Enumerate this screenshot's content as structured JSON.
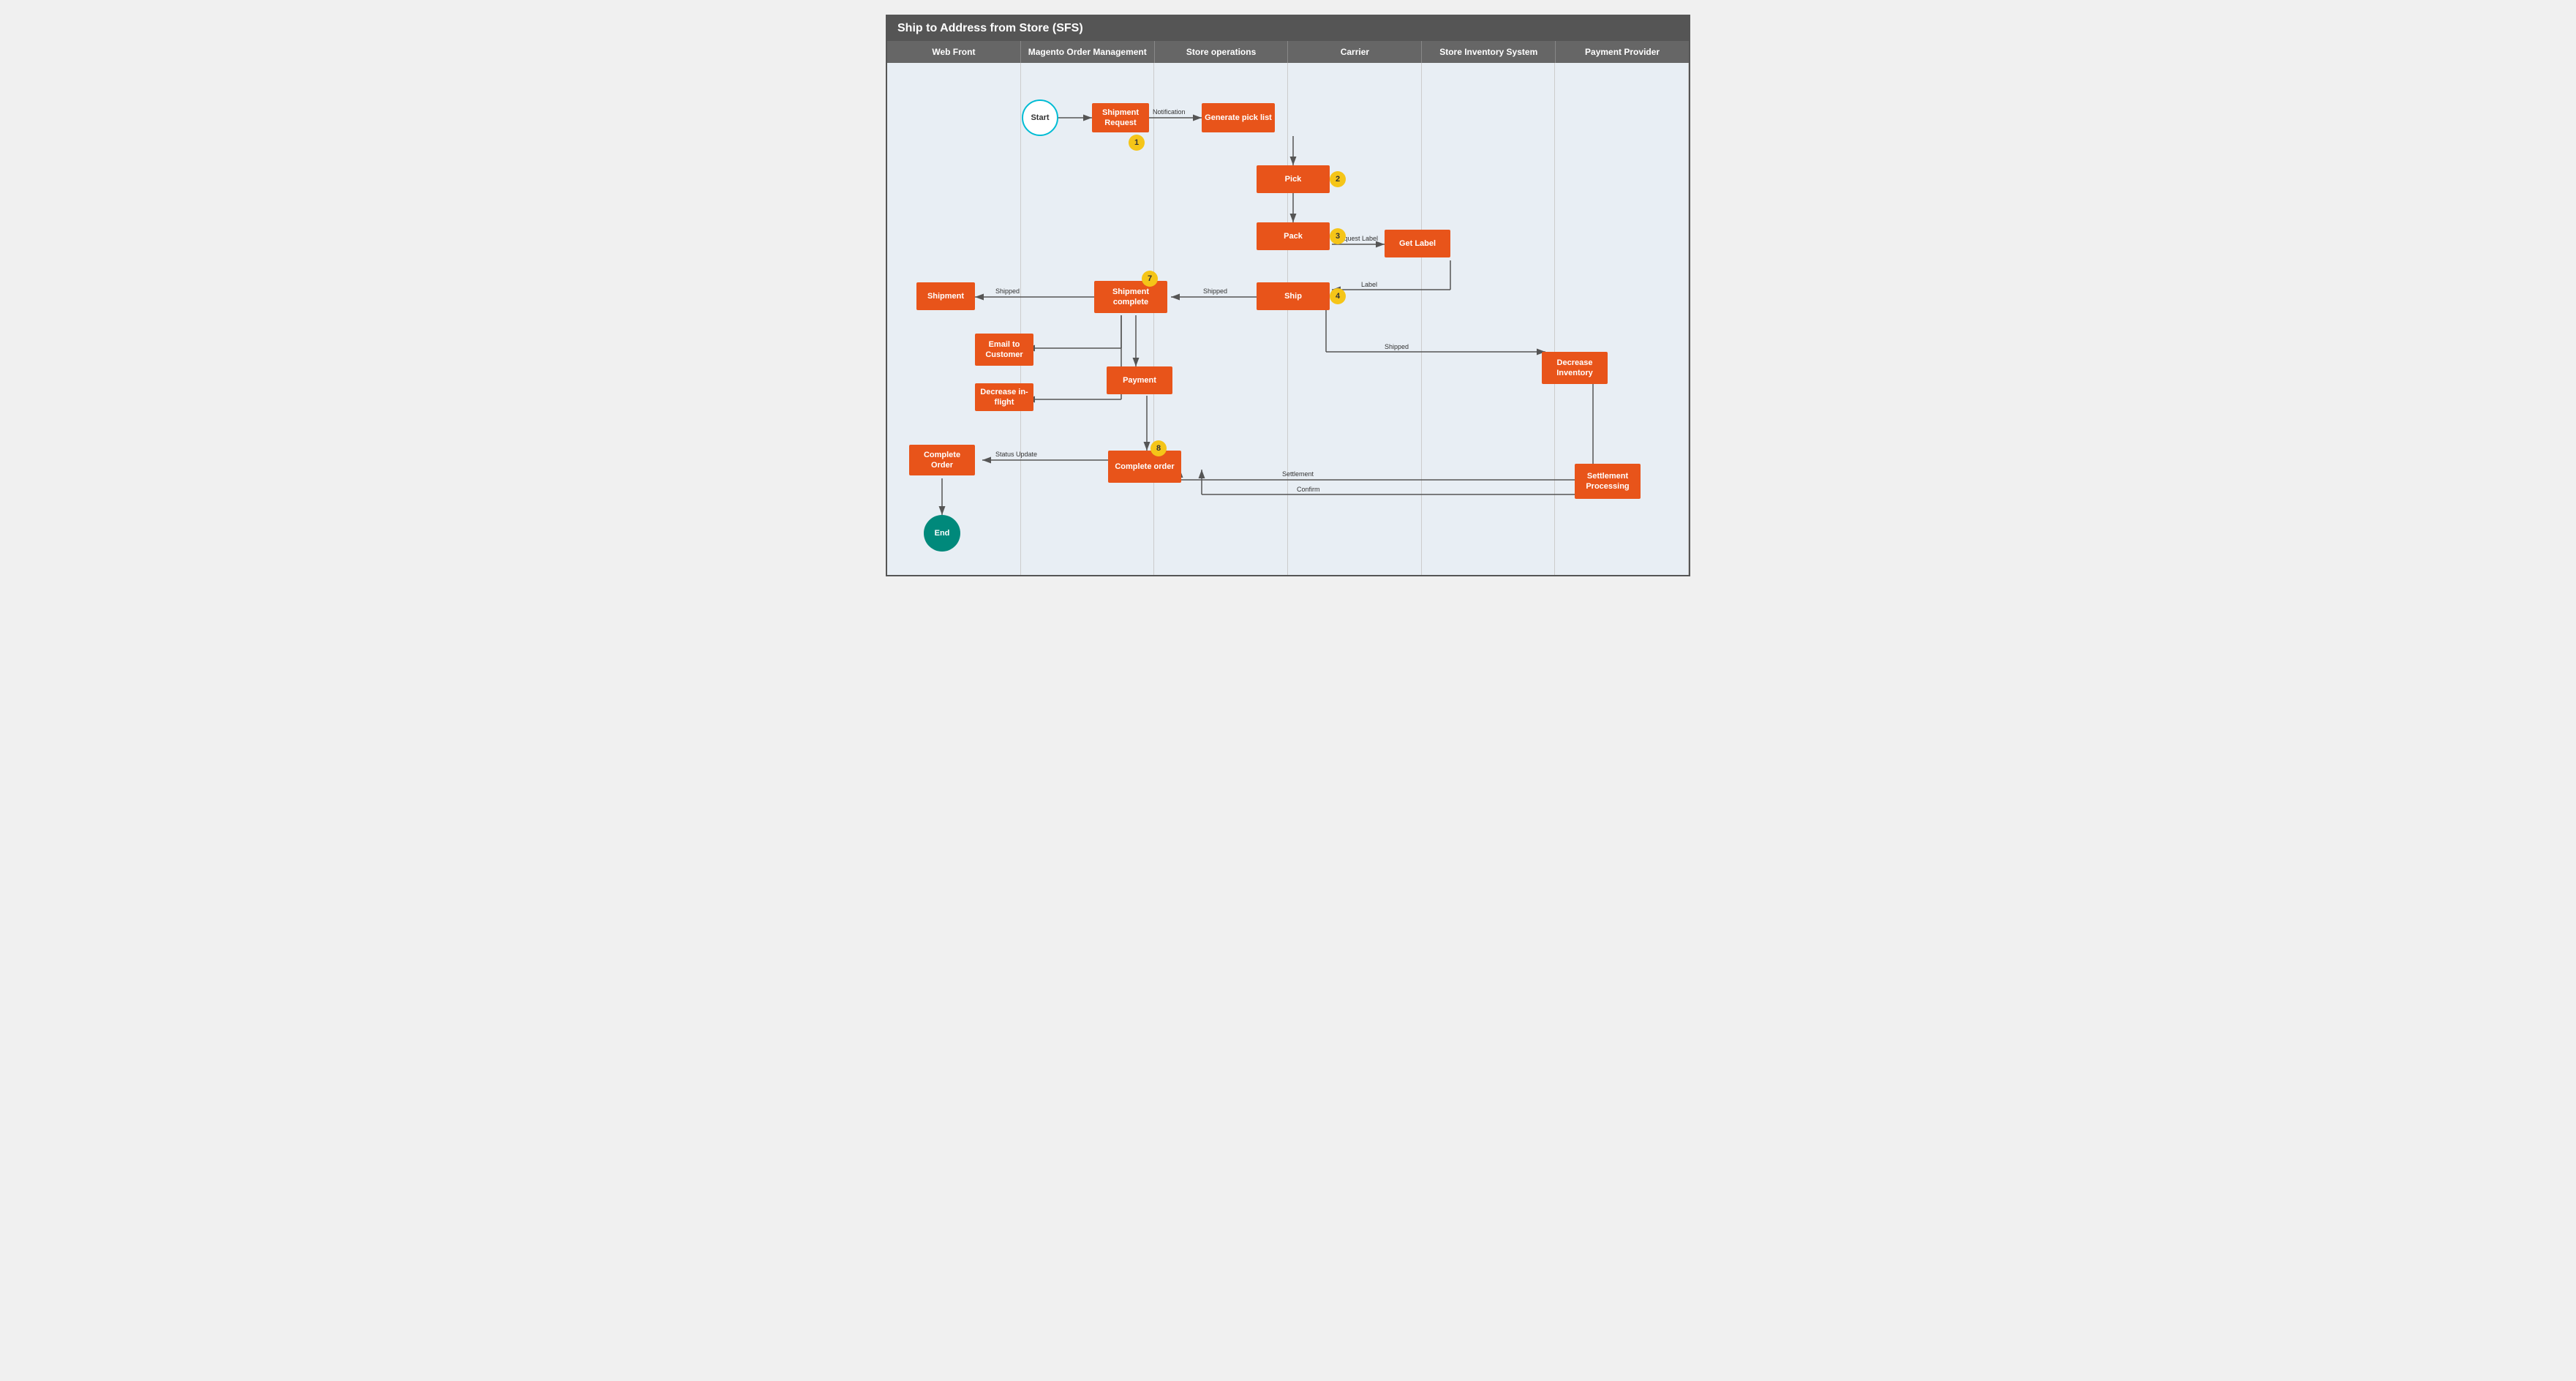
{
  "title": "Ship to Address from Store (SFS)",
  "lanes": [
    {
      "label": "Web Front"
    },
    {
      "label": "Magento Order Management"
    },
    {
      "label": "Store operations"
    },
    {
      "label": "Carrier"
    },
    {
      "label": "Store Inventory System"
    },
    {
      "label": "Payment Provider"
    }
  ],
  "nodes": {
    "start": {
      "label": "Start"
    },
    "shipmentRequest": {
      "label": "Shipment Request"
    },
    "generatePickList": {
      "label": "Generate pick list"
    },
    "pick": {
      "label": "Pick"
    },
    "pack": {
      "label": "Pack"
    },
    "getLabel": {
      "label": "Get Label"
    },
    "ship": {
      "label": "Ship"
    },
    "shipmentComplete": {
      "label": "Shipment complete"
    },
    "shipment": {
      "label": "Shipment"
    },
    "emailToCustomer": {
      "label": "Email to Customer"
    },
    "decreaseInflight": {
      "label": "Decrease in-flight"
    },
    "payment": {
      "label": "Payment"
    },
    "completeOrder": {
      "label": "Complete order"
    },
    "completeOrderWeb": {
      "label": "Complete Order"
    },
    "decreaseInventory": {
      "label": "Decrease Inventory"
    },
    "settlementProcessing": {
      "label": "Settlement Processing"
    },
    "end": {
      "label": "End"
    }
  },
  "badges": {
    "1": "1",
    "2": "2",
    "3": "3",
    "4": "4",
    "7": "7",
    "8": "8"
  },
  "arrowLabels": {
    "notification": "Notification",
    "requestLabel": "Request Label",
    "label": "Label",
    "shipped1": "Shipped",
    "shipped2": "Shipped",
    "shipped3": "Shipped",
    "settlement": "Settlement",
    "confirm": "Confirm",
    "statusUpdate": "Status Update"
  },
  "colors": {
    "box": "#e8541a",
    "startCircle": "#00bcd4",
    "endCircle": "#00897b",
    "badge": "#f5c518",
    "arrow": "#555",
    "header": "#666",
    "titleBar": "#555555"
  }
}
